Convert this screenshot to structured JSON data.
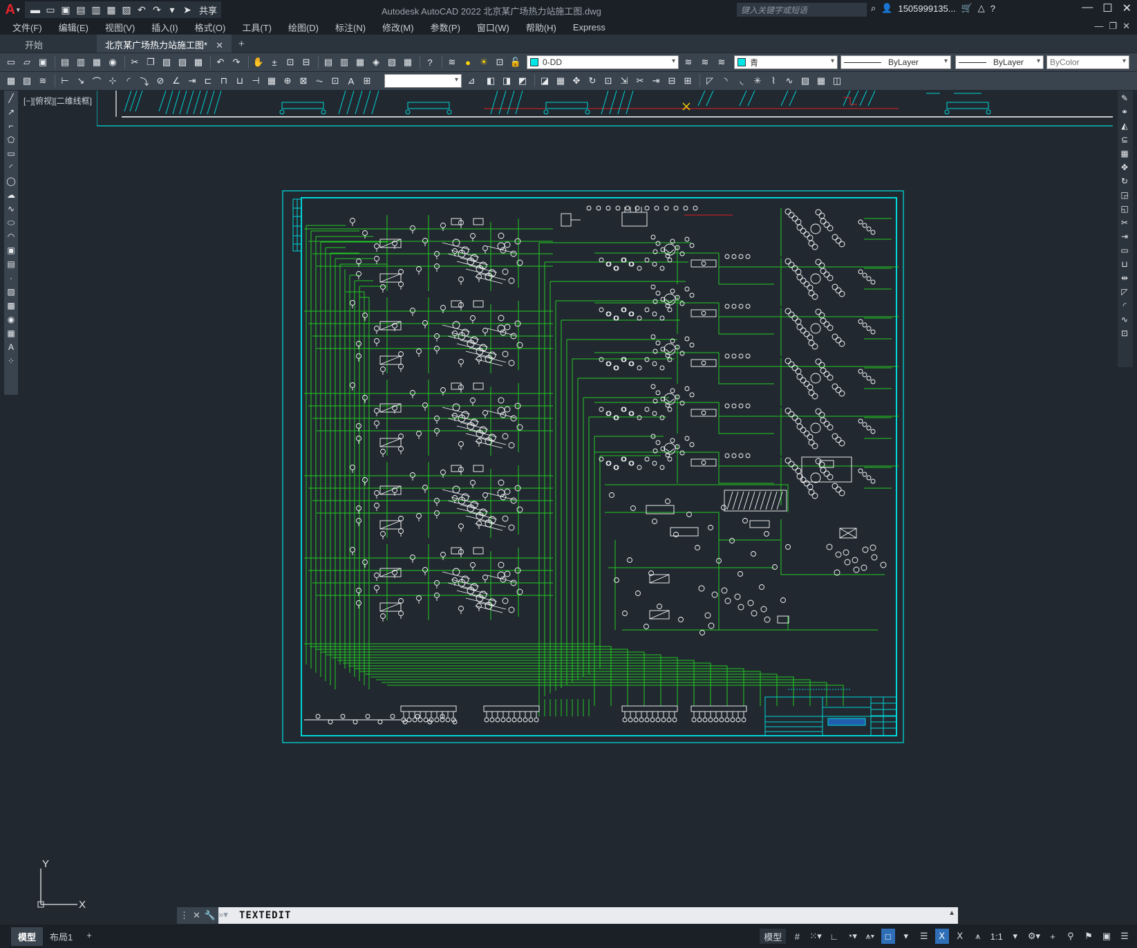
{
  "app": {
    "title": "Autodesk AutoCAD 2022    北京某广场热力站施工图.dwg",
    "logo": "A",
    "share_label": "共享",
    "search_placeholder": "键入关键字或短语",
    "user": "1505999135...",
    "window_controls": [
      "—",
      "☐",
      "✕"
    ]
  },
  "menu": {
    "items": [
      "文件(F)",
      "编辑(E)",
      "视图(V)",
      "插入(I)",
      "格式(O)",
      "工具(T)",
      "绘图(D)",
      "标注(N)",
      "修改(M)",
      "参数(P)",
      "窗口(W)",
      "帮助(H)",
      "Express"
    ]
  },
  "tabs": {
    "items": [
      {
        "label": "开始",
        "active": false
      },
      {
        "label": "北京某广场热力站施工图*",
        "active": true
      }
    ],
    "close_glyph": "✕",
    "add_glyph": "+"
  },
  "properties": {
    "layer": "0-DD",
    "color": "青",
    "linetype": "ByLayer",
    "lineweight": "ByLayer",
    "plotstyle": "ByColor",
    "layer_swatch": "#00e5e5",
    "color_swatch": "#00e5e5"
  },
  "viewport": {
    "label": "[−][俯视][二维线框]"
  },
  "command": {
    "text": "TEXTEDIT"
  },
  "ucs": {
    "x_label": "X",
    "y_label": "Y"
  },
  "status": {
    "layout_tabs": [
      {
        "label": "模型",
        "active": true
      },
      {
        "label": "布局1",
        "active": false
      }
    ],
    "add_layout": "+",
    "model_label": "模型",
    "scale": "1:1"
  },
  "colors": {
    "frame": "#00d7d7",
    "pipe": "#22cc22",
    "symbol": "#ffffff",
    "background": "#212830"
  }
}
